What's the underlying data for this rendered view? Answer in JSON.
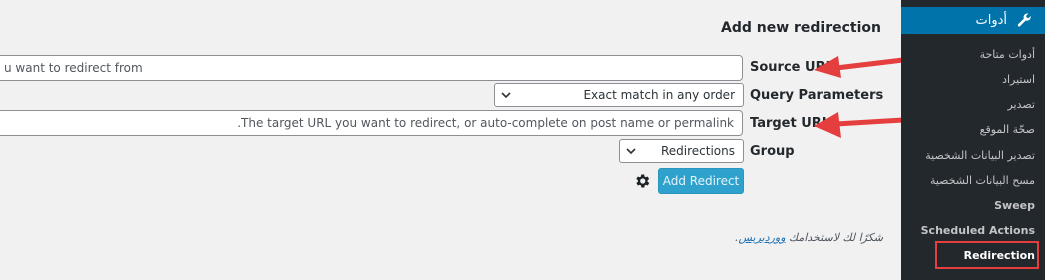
{
  "form": {
    "title": "Add new redirection",
    "source_label": "Source URL",
    "source_placeholder": "u want to redirect from",
    "query_label": "Query Parameters",
    "query_value": "Exact match in any order",
    "target_label": "Target URL",
    "target_placeholder": ".The target URL you want to redirect, or auto-complete on post name or permalink",
    "group_label": "Group",
    "group_value": "Redirections",
    "add_button": "Add Redirect"
  },
  "footer": {
    "thanks_prefix": "شكرًا لك لاستخدامك ",
    "thanks_link": "ووردبريس",
    "thanks_suffix": "."
  },
  "sidebar": {
    "section_title": "أدوات",
    "items": [
      {
        "label": "أدوات متاحة"
      },
      {
        "label": "استيراد"
      },
      {
        "label": "تصدير"
      },
      {
        "label": "صحّة الموقع"
      },
      {
        "label": "تصدير البيانات الشخصية"
      },
      {
        "label": "مسح البيانات الشخصية"
      },
      {
        "label": "Sweep"
      },
      {
        "label": "Scheduled Actions"
      },
      {
        "label": "Redirection"
      }
    ]
  },
  "colors": {
    "accent": "#0073aa",
    "button": "#2ea2cc",
    "annotation_red": "#e53e3e",
    "sidebar_bg": "#23282d"
  },
  "icons": {
    "sidebar_head": "wrench-icon",
    "options": "gear-icon",
    "select": "chevron-down-icon"
  }
}
